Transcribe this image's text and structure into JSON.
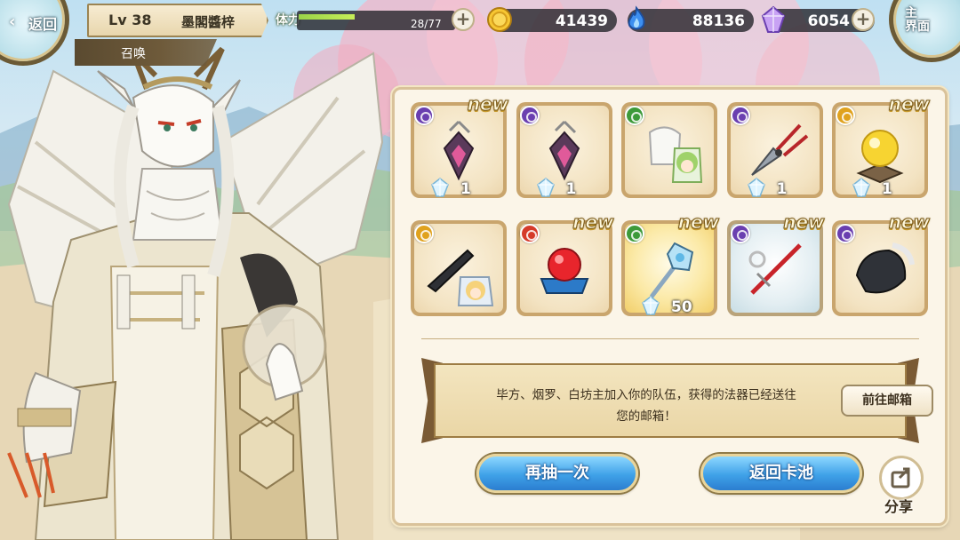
{
  "topbar": {
    "back_label": "返回",
    "level": "Lv 38",
    "player_name": "墨閣醬梓",
    "screen_title": "召唤",
    "stamina_label": "体力",
    "stamina_current": 28,
    "stamina_max": 77,
    "stamina_text": "28/77",
    "gold": "41439",
    "spirit": "88136",
    "crystal": "6054",
    "main_label_1": "主",
    "main_label_2": "界面"
  },
  "results": [
    {
      "element": "purple",
      "new_label": "new",
      "qty": "1",
      "art": "pendant-icon",
      "frame": "normal"
    },
    {
      "element": "purple",
      "new_label": "",
      "qty": "1",
      "art": "pendant-icon",
      "frame": "normal"
    },
    {
      "element": "green",
      "new_label": "",
      "qty": "",
      "art": "character-portrait-icon",
      "frame": "normal"
    },
    {
      "element": "purple",
      "new_label": "",
      "qty": "1",
      "art": "blade-icon",
      "frame": "normal"
    },
    {
      "element": "gold",
      "new_label": "new",
      "qty": "1",
      "art": "crystal-ball-icon",
      "frame": "normal"
    },
    {
      "element": "gold",
      "new_label": "",
      "qty": "",
      "art": "knife-portrait-icon",
      "frame": "normal"
    },
    {
      "element": "red",
      "new_label": "new",
      "qty": "",
      "art": "red-orb-icon",
      "frame": "normal"
    },
    {
      "element": "green",
      "new_label": "new",
      "qty": "50",
      "art": "staff-icon",
      "frame": "gold"
    },
    {
      "element": "purple",
      "new_label": "new",
      "qty": "",
      "art": "sword-icon",
      "frame": "blue"
    },
    {
      "element": "purple",
      "new_label": "new",
      "qty": "",
      "art": "stone-icon",
      "frame": "normal"
    }
  ],
  "notice": {
    "message": "毕方、烟罗、白坊主加入你的队伍，获得的法器已经送往您的邮箱！",
    "mail_button": "前往邮箱"
  },
  "actions": {
    "draw_again": "再抽一次",
    "return_pool": "返回卡池",
    "share": "分享"
  },
  "colors": {
    "element_purple": "#6a3fb0",
    "element_green": "#3d9a3a",
    "element_gold": "#e0a21e",
    "element_red": "#d53a2a",
    "button_blue": "#3fa1e8"
  }
}
